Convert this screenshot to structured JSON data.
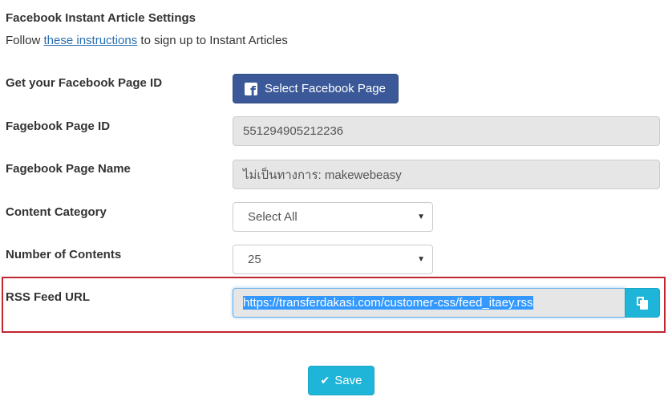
{
  "header": {
    "title": "Facebook Instant Article Settings",
    "intro_prefix": "Follow ",
    "intro_link": "these instructions",
    "intro_suffix": " to sign up to Instant Articles"
  },
  "fields": {
    "page_id_lookup": {
      "label": "Get your Facebook Page ID",
      "button_label": "Select Facebook Page"
    },
    "page_id": {
      "label": "Fagebook Page ID",
      "value": "551294905212236"
    },
    "page_name": {
      "label": "Fagebook Page Name",
      "value": "ไม่เป็นทางการ: makewebeasy"
    },
    "content_category": {
      "label": "Content Category",
      "selected": "Select All"
    },
    "number_of_contents": {
      "label": "Number of Contents",
      "selected": "25"
    },
    "rss_feed": {
      "label": "RSS Feed URL",
      "value": "https://transferdakasi.com/customer-css/feed_itaey.rss"
    }
  },
  "footer": {
    "save_label": "Save"
  },
  "icons": {
    "facebook": "facebook-icon",
    "copy": "copy-icon",
    "check": "check-icon",
    "caret": "caret-down-icon"
  },
  "colors": {
    "facebook_blue": "#3b5998",
    "accent_cyan": "#1fb5d8",
    "highlight_red": "#c0262d",
    "link": "#2a6fb0"
  }
}
